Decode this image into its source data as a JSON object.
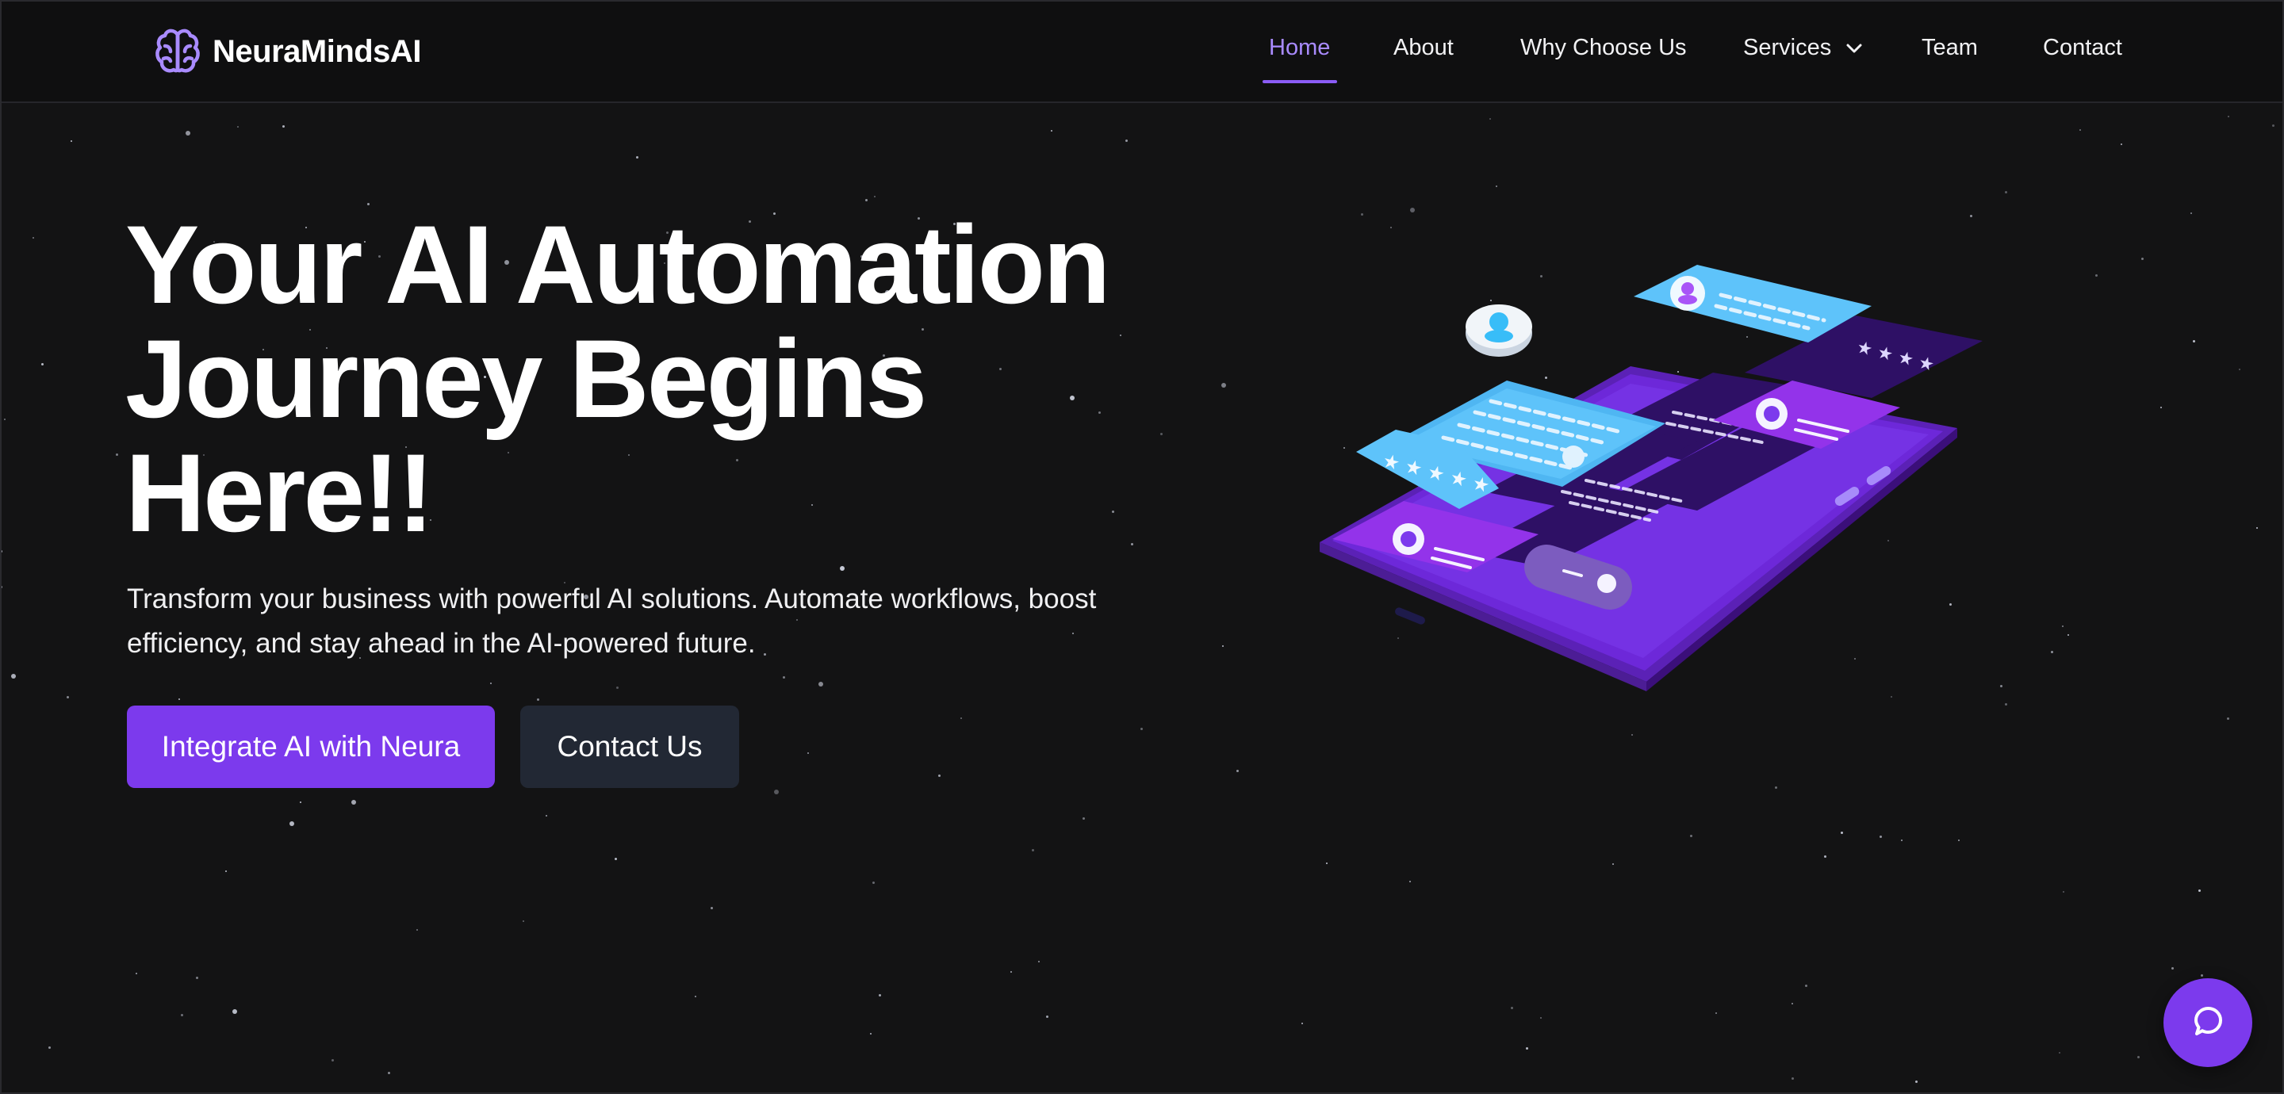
{
  "brand": {
    "name": "NeuraMindsAI",
    "logo_icon": "brain-icon"
  },
  "nav": {
    "items": [
      {
        "label": "Home",
        "active": true
      },
      {
        "label": "About",
        "active": false
      },
      {
        "label": "Why Choose Us",
        "active": false
      },
      {
        "label": "Services",
        "active": false,
        "has_dropdown": true
      },
      {
        "label": "Team",
        "active": false
      },
      {
        "label": "Contact",
        "active": false
      }
    ]
  },
  "hero": {
    "title_lines": [
      "Your AI Automation",
      "Journey Begins",
      "Here!!"
    ],
    "subtitle": "Transform your business with powerful AI solutions. Automate workflows, boost efficiency, and stay ahead in the AI-powered future.",
    "primary_button": "Integrate AI with Neura",
    "secondary_button": "Contact Us",
    "illustration_icon": "isometric-phone-chat-illustration"
  },
  "chat_widget": {
    "icon": "chat-bubble-icon"
  },
  "colors": {
    "background": "#131314",
    "accent": "#7c3aed",
    "active_nav": "#a98bff",
    "secondary_button": "#222834"
  }
}
